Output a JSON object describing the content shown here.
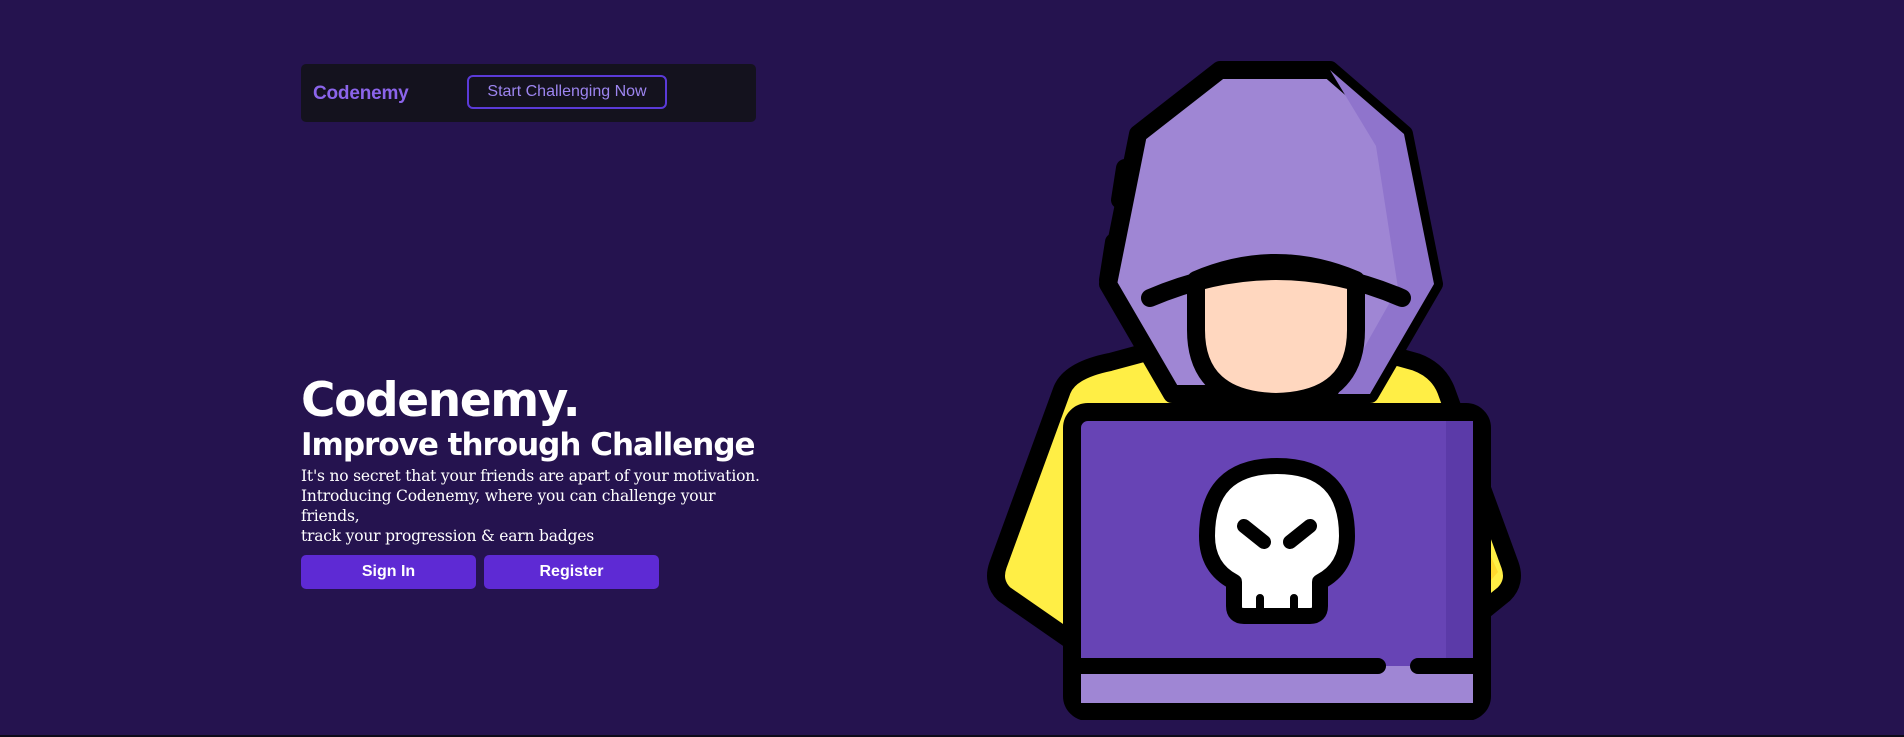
{
  "navbar": {
    "brand": "Codenemy",
    "cta_label": "Start Challenging Now"
  },
  "hero": {
    "title": "Codenemy.",
    "subtitle": "Improve through Challenge",
    "description_line1": "It's no secret that your friends are apart of your motivation.",
    "description_line2": "Introducing Codenemy, where you can challenge your friends,",
    "description_line3": "track your progression & earn badges",
    "sign_in_label": "Sign In",
    "register_label": "Register"
  },
  "illustration": {
    "icon": "hooded-hacker-with-skull-laptop-icon"
  },
  "colors": {
    "background": "#25134f",
    "navbar_bg": "#14121e",
    "accent": "#5e2ad4",
    "brand": "#8b64ea",
    "hood": "#9f86d4",
    "jacket": "#ffee45",
    "face": "#ffd7bf",
    "laptop": "#6744b5"
  }
}
